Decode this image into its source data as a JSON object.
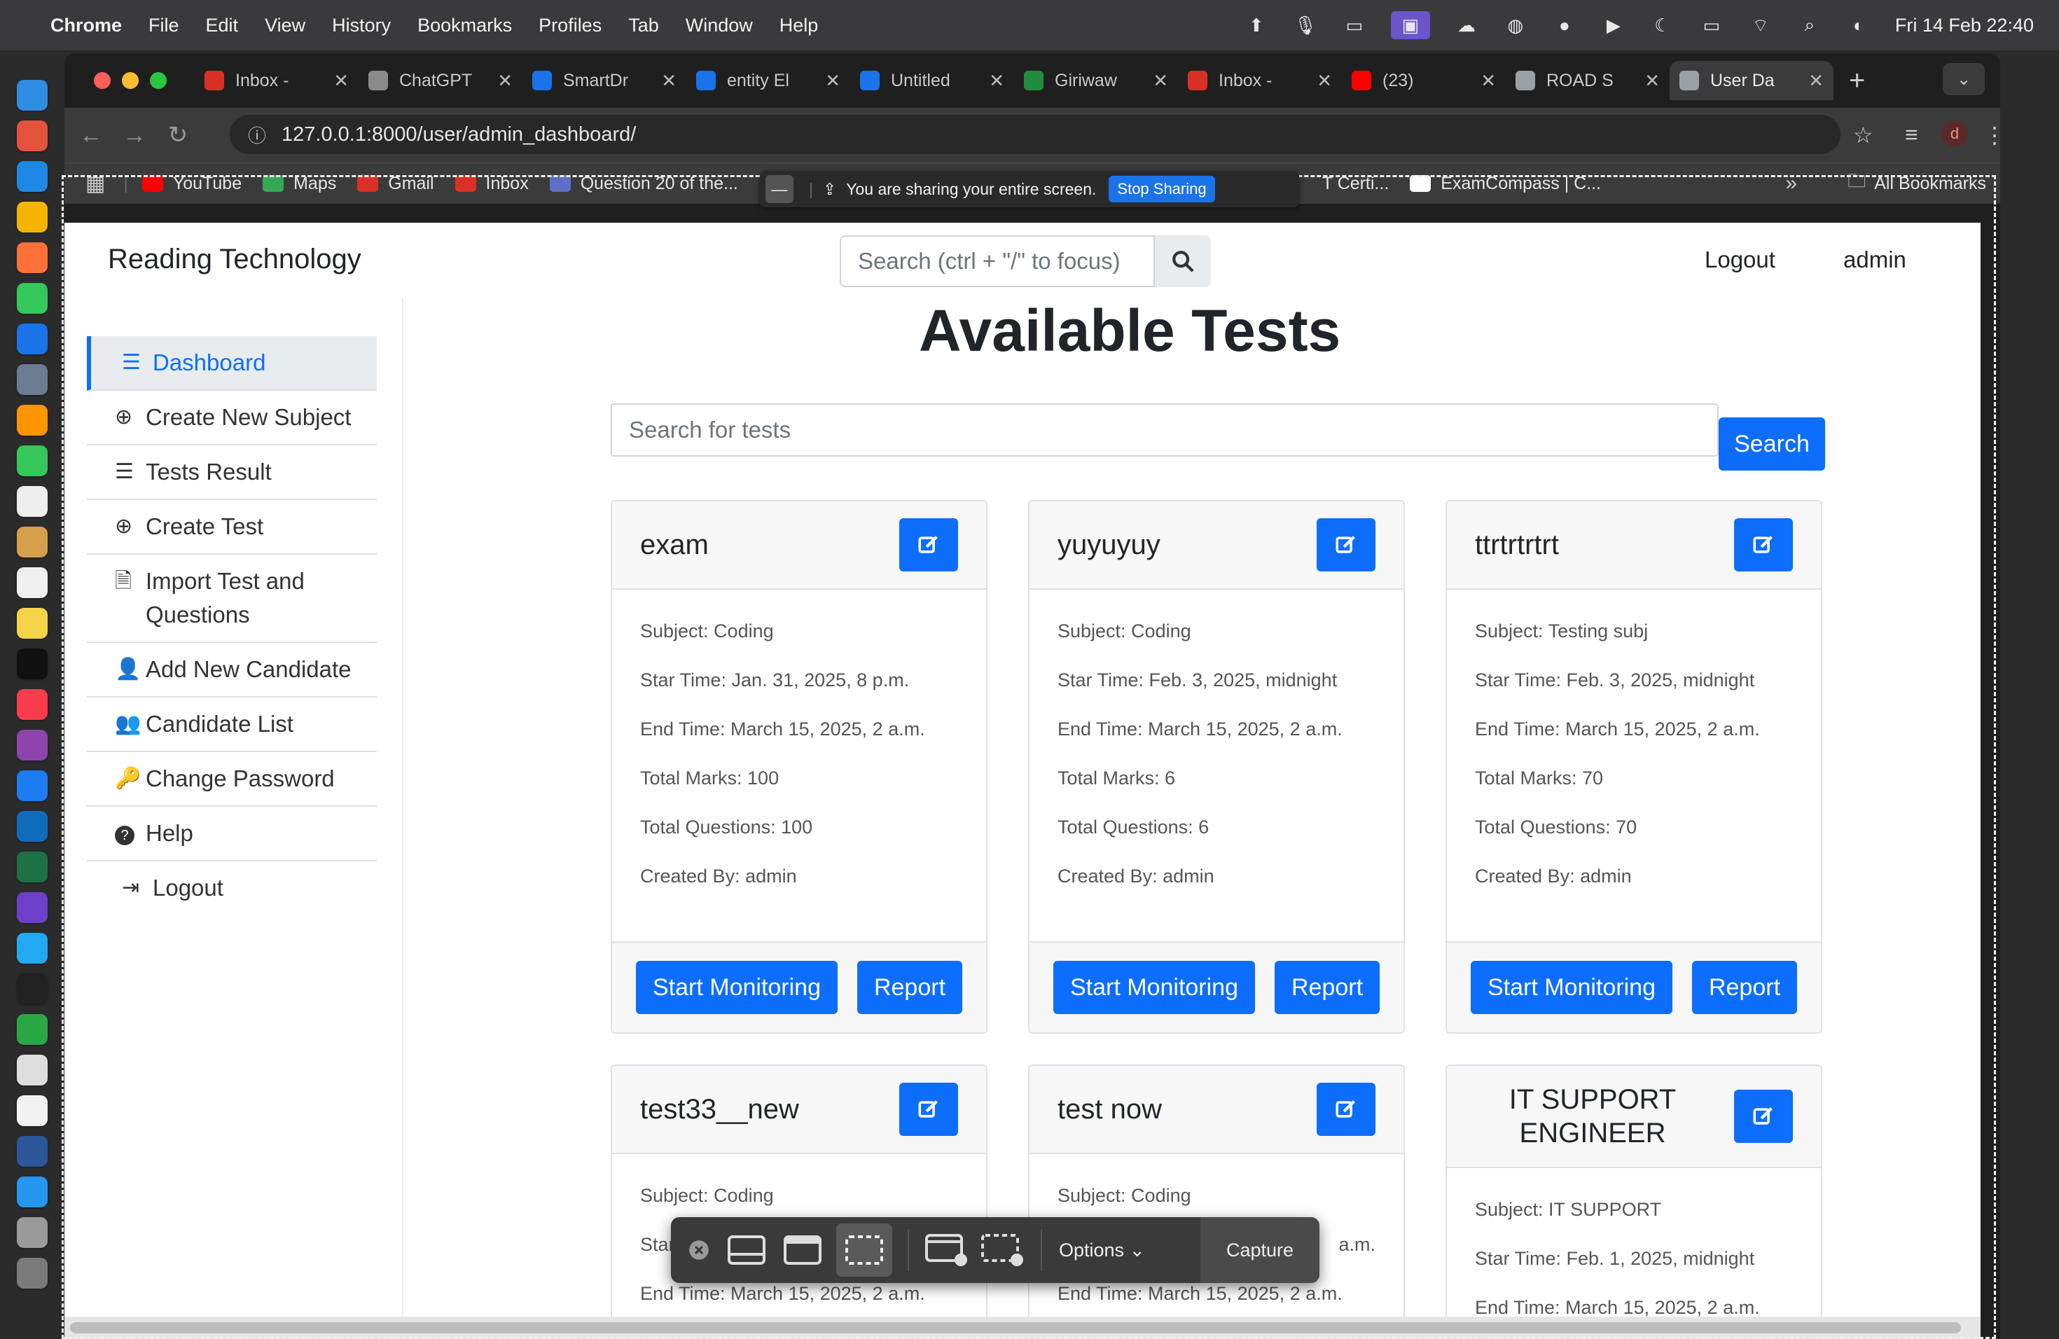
{
  "menubar": {
    "app": "Chrome",
    "items": [
      "File",
      "Edit",
      "View",
      "History",
      "Bookmarks",
      "Profiles",
      "Tab",
      "Window",
      "Help"
    ],
    "clock": "Fri 14 Feb  22:40"
  },
  "tabs": [
    {
      "title": "Inbox - ",
      "color": "#d93025"
    },
    {
      "title": "ChatGPT",
      "color": "#8a8a8a"
    },
    {
      "title": "SmartDr",
      "color": "#1a73e8"
    },
    {
      "title": "entity El",
      "color": "#1a73e8"
    },
    {
      "title": "Untitled",
      "color": "#1a73e8"
    },
    {
      "title": "Giriwaw",
      "color": "#1e8e3e"
    },
    {
      "title": "Inbox - ",
      "color": "#d93025"
    },
    {
      "title": "(23)",
      "color": "#ff0000"
    },
    {
      "title": "ROAD S",
      "color": "#9aa0a6"
    },
    {
      "title": "User Da",
      "color": "#9aa0a6",
      "active": true
    }
  ],
  "address_bar": {
    "url": "127.0.0.1:8000/user/admin_dashboard/"
  },
  "bookmarks": [
    {
      "label": "YouTube",
      "color": "#ff0000"
    },
    {
      "label": "Maps",
      "color": "#34a853"
    },
    {
      "label": "Gmail",
      "color": "#d93025"
    },
    {
      "label": "Inbox",
      "color": "#d93025"
    },
    {
      "label": "Question 20 of the...",
      "color": "#5f6fc7"
    },
    {
      "label": "T Certi...",
      "color": "#3b3b3b"
    },
    {
      "label": "ExamCompass | C...",
      "color": "#ffffff"
    }
  ],
  "all_bookmarks": "All Bookmarks",
  "share_banner": {
    "text": "You are sharing your entire screen.",
    "stop": "Stop Sharing"
  },
  "page": {
    "brand": "Reading Technology",
    "search_placeholder": "Search (ctrl + \"/\" to focus)",
    "nav_logout": "Logout",
    "nav_user": "admin",
    "title": "Available Tests",
    "test_search_placeholder": "Search for tests",
    "test_search_button": "Search"
  },
  "sidebar": [
    {
      "label": "Dashboard",
      "icon": "list-icon",
      "active": true
    },
    {
      "label": "Create New Subject",
      "icon": "plus-circle-icon"
    },
    {
      "label": "Tests Result",
      "icon": "list-icon"
    },
    {
      "label": "Create Test",
      "icon": "plus-circle-icon"
    },
    {
      "label": "Import Test and Questions",
      "icon": "file-import-icon"
    },
    {
      "label": "Add New Candidate",
      "icon": "user-plus-icon"
    },
    {
      "label": "Candidate List",
      "icon": "users-icon"
    },
    {
      "label": "Change Password",
      "icon": "key-icon"
    },
    {
      "label": "Help",
      "icon": "question-circle-icon"
    },
    {
      "label": "Logout",
      "icon": "sign-out-icon"
    }
  ],
  "cards": [
    {
      "title": "exam",
      "subject": "Subject: Coding",
      "start": "Star Time: Jan. 31, 2025, 8 p.m.",
      "end": "End Time: March 15, 2025, 2 a.m.",
      "marks": "Total Marks: 100",
      "questions": "Total Questions: 100",
      "created": "Created By: admin",
      "monitor": "Start Monitoring",
      "report": "Report"
    },
    {
      "title": "yuyuyuy",
      "subject": "Subject: Coding",
      "start": "Star Time: Feb. 3, 2025, midnight",
      "end": "End Time: March 15, 2025, 2 a.m.",
      "marks": "Total Marks: 6",
      "questions": "Total Questions: 6",
      "created": "Created By: admin",
      "monitor": "Start Monitoring",
      "report": "Report"
    },
    {
      "title": "ttrtrtrtrt",
      "subject": "Subject: Testing subj",
      "start": "Star Time: Feb. 3, 2025, midnight",
      "end": "End Time: March 15, 2025, 2 a.m.",
      "marks": "Total Marks: 70",
      "questions": "Total Questions: 70",
      "created": "Created By: admin",
      "monitor": "Start Monitoring",
      "report": "Report"
    },
    {
      "title": "test33__new",
      "subject": "Subject: Coding",
      "start": "Star",
      "end": "End Time: March 15, 2025, 2 a.m."
    },
    {
      "title": "test now",
      "subject": "Subject: Coding",
      "start": "a.m.",
      "end": "End Time: March 15, 2025, 2 a.m."
    },
    {
      "title": "IT SUPPORT ENGINEER",
      "subject": "Subject: IT SUPPORT",
      "start": "Star Time: Feb. 1, 2025, midnight",
      "end": "End Time: March 15, 2025, 2 a.m."
    }
  ],
  "capture_toolbar": {
    "options": "Options ⌄",
    "capture": "Capture"
  }
}
